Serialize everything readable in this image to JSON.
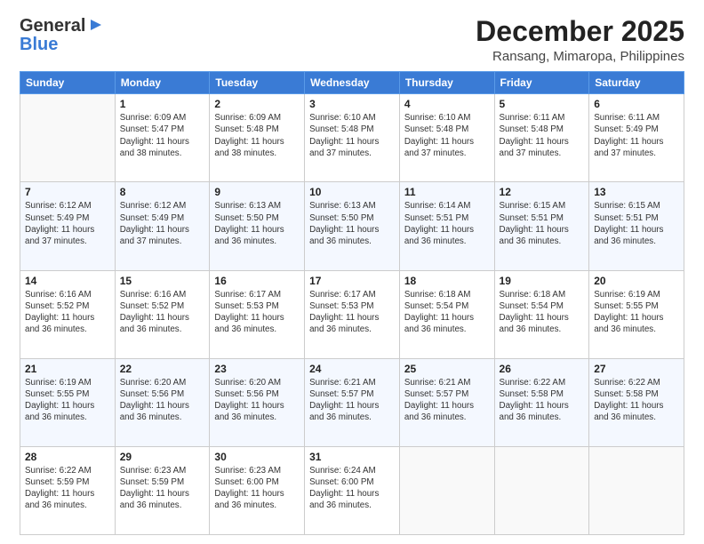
{
  "header": {
    "logo_general": "General",
    "logo_blue": "Blue",
    "month_title": "December 2025",
    "location": "Ransang, Mimaropa, Philippines"
  },
  "days_of_week": [
    "Sunday",
    "Monday",
    "Tuesday",
    "Wednesday",
    "Thursday",
    "Friday",
    "Saturday"
  ],
  "weeks": [
    [
      {
        "day": "",
        "sunrise": "",
        "sunset": "",
        "daylight": ""
      },
      {
        "day": "1",
        "sunrise": "Sunrise: 6:09 AM",
        "sunset": "Sunset: 5:47 PM",
        "daylight": "Daylight: 11 hours and 38 minutes."
      },
      {
        "day": "2",
        "sunrise": "Sunrise: 6:09 AM",
        "sunset": "Sunset: 5:48 PM",
        "daylight": "Daylight: 11 hours and 38 minutes."
      },
      {
        "day": "3",
        "sunrise": "Sunrise: 6:10 AM",
        "sunset": "Sunset: 5:48 PM",
        "daylight": "Daylight: 11 hours and 37 minutes."
      },
      {
        "day": "4",
        "sunrise": "Sunrise: 6:10 AM",
        "sunset": "Sunset: 5:48 PM",
        "daylight": "Daylight: 11 hours and 37 minutes."
      },
      {
        "day": "5",
        "sunrise": "Sunrise: 6:11 AM",
        "sunset": "Sunset: 5:48 PM",
        "daylight": "Daylight: 11 hours and 37 minutes."
      },
      {
        "day": "6",
        "sunrise": "Sunrise: 6:11 AM",
        "sunset": "Sunset: 5:49 PM",
        "daylight": "Daylight: 11 hours and 37 minutes."
      }
    ],
    [
      {
        "day": "7",
        "sunrise": "Sunrise: 6:12 AM",
        "sunset": "Sunset: 5:49 PM",
        "daylight": "Daylight: 11 hours and 37 minutes."
      },
      {
        "day": "8",
        "sunrise": "Sunrise: 6:12 AM",
        "sunset": "Sunset: 5:49 PM",
        "daylight": "Daylight: 11 hours and 37 minutes."
      },
      {
        "day": "9",
        "sunrise": "Sunrise: 6:13 AM",
        "sunset": "Sunset: 5:50 PM",
        "daylight": "Daylight: 11 hours and 36 minutes."
      },
      {
        "day": "10",
        "sunrise": "Sunrise: 6:13 AM",
        "sunset": "Sunset: 5:50 PM",
        "daylight": "Daylight: 11 hours and 36 minutes."
      },
      {
        "day": "11",
        "sunrise": "Sunrise: 6:14 AM",
        "sunset": "Sunset: 5:51 PM",
        "daylight": "Daylight: 11 hours and 36 minutes."
      },
      {
        "day": "12",
        "sunrise": "Sunrise: 6:15 AM",
        "sunset": "Sunset: 5:51 PM",
        "daylight": "Daylight: 11 hours and 36 minutes."
      },
      {
        "day": "13",
        "sunrise": "Sunrise: 6:15 AM",
        "sunset": "Sunset: 5:51 PM",
        "daylight": "Daylight: 11 hours and 36 minutes."
      }
    ],
    [
      {
        "day": "14",
        "sunrise": "Sunrise: 6:16 AM",
        "sunset": "Sunset: 5:52 PM",
        "daylight": "Daylight: 11 hours and 36 minutes."
      },
      {
        "day": "15",
        "sunrise": "Sunrise: 6:16 AM",
        "sunset": "Sunset: 5:52 PM",
        "daylight": "Daylight: 11 hours and 36 minutes."
      },
      {
        "day": "16",
        "sunrise": "Sunrise: 6:17 AM",
        "sunset": "Sunset: 5:53 PM",
        "daylight": "Daylight: 11 hours and 36 minutes."
      },
      {
        "day": "17",
        "sunrise": "Sunrise: 6:17 AM",
        "sunset": "Sunset: 5:53 PM",
        "daylight": "Daylight: 11 hours and 36 minutes."
      },
      {
        "day": "18",
        "sunrise": "Sunrise: 6:18 AM",
        "sunset": "Sunset: 5:54 PM",
        "daylight": "Daylight: 11 hours and 36 minutes."
      },
      {
        "day": "19",
        "sunrise": "Sunrise: 6:18 AM",
        "sunset": "Sunset: 5:54 PM",
        "daylight": "Daylight: 11 hours and 36 minutes."
      },
      {
        "day": "20",
        "sunrise": "Sunrise: 6:19 AM",
        "sunset": "Sunset: 5:55 PM",
        "daylight": "Daylight: 11 hours and 36 minutes."
      }
    ],
    [
      {
        "day": "21",
        "sunrise": "Sunrise: 6:19 AM",
        "sunset": "Sunset: 5:55 PM",
        "daylight": "Daylight: 11 hours and 36 minutes."
      },
      {
        "day": "22",
        "sunrise": "Sunrise: 6:20 AM",
        "sunset": "Sunset: 5:56 PM",
        "daylight": "Daylight: 11 hours and 36 minutes."
      },
      {
        "day": "23",
        "sunrise": "Sunrise: 6:20 AM",
        "sunset": "Sunset: 5:56 PM",
        "daylight": "Daylight: 11 hours and 36 minutes."
      },
      {
        "day": "24",
        "sunrise": "Sunrise: 6:21 AM",
        "sunset": "Sunset: 5:57 PM",
        "daylight": "Daylight: 11 hours and 36 minutes."
      },
      {
        "day": "25",
        "sunrise": "Sunrise: 6:21 AM",
        "sunset": "Sunset: 5:57 PM",
        "daylight": "Daylight: 11 hours and 36 minutes."
      },
      {
        "day": "26",
        "sunrise": "Sunrise: 6:22 AM",
        "sunset": "Sunset: 5:58 PM",
        "daylight": "Daylight: 11 hours and 36 minutes."
      },
      {
        "day": "27",
        "sunrise": "Sunrise: 6:22 AM",
        "sunset": "Sunset: 5:58 PM",
        "daylight": "Daylight: 11 hours and 36 minutes."
      }
    ],
    [
      {
        "day": "28",
        "sunrise": "Sunrise: 6:22 AM",
        "sunset": "Sunset: 5:59 PM",
        "daylight": "Daylight: 11 hours and 36 minutes."
      },
      {
        "day": "29",
        "sunrise": "Sunrise: 6:23 AM",
        "sunset": "Sunset: 5:59 PM",
        "daylight": "Daylight: 11 hours and 36 minutes."
      },
      {
        "day": "30",
        "sunrise": "Sunrise: 6:23 AM",
        "sunset": "Sunset: 6:00 PM",
        "daylight": "Daylight: 11 hours and 36 minutes."
      },
      {
        "day": "31",
        "sunrise": "Sunrise: 6:24 AM",
        "sunset": "Sunset: 6:00 PM",
        "daylight": "Daylight: 11 hours and 36 minutes."
      },
      {
        "day": "",
        "sunrise": "",
        "sunset": "",
        "daylight": ""
      },
      {
        "day": "",
        "sunrise": "",
        "sunset": "",
        "daylight": ""
      },
      {
        "day": "",
        "sunrise": "",
        "sunset": "",
        "daylight": ""
      }
    ]
  ]
}
